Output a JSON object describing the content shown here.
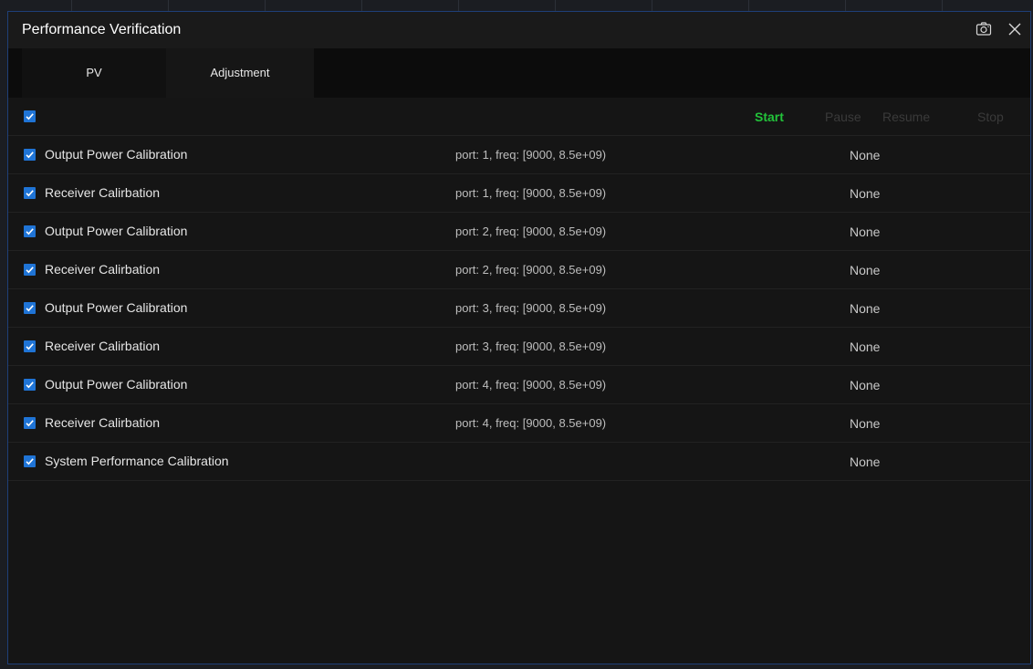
{
  "window": {
    "title": "Performance Verification"
  },
  "tabs": [
    {
      "label": "PV"
    },
    {
      "label": "Adjustment"
    }
  ],
  "toolbar": {
    "select_all_checked": true,
    "start_label": "Start",
    "pause_label": "Pause",
    "resume_label": "Resume",
    "stop_label": "Stop"
  },
  "colors": {
    "accent": "#1f74d6",
    "start": "#22c33a",
    "disabled": "#3a3a3a",
    "window_border": "#1f3f78"
  },
  "icons": {
    "screenshot": "camera-icon",
    "close": "close-icon",
    "check": "checkmark-icon"
  },
  "rows": [
    {
      "checked": true,
      "name": "Output Power Calibration",
      "params": "port: 1, freq: [9000, 8.5e+09)",
      "result": "None"
    },
    {
      "checked": true,
      "name": "Receiver Calirbation",
      "params": "port: 1, freq: [9000, 8.5e+09)",
      "result": "None"
    },
    {
      "checked": true,
      "name": "Output Power Calibration",
      "params": "port: 2, freq: [9000, 8.5e+09)",
      "result": "None"
    },
    {
      "checked": true,
      "name": "Receiver Calirbation",
      "params": "port: 2, freq: [9000, 8.5e+09)",
      "result": "None"
    },
    {
      "checked": true,
      "name": "Output Power Calibration",
      "params": "port: 3, freq: [9000, 8.5e+09)",
      "result": "None"
    },
    {
      "checked": true,
      "name": "Receiver Calirbation",
      "params": "port: 3, freq: [9000, 8.5e+09)",
      "result": "None"
    },
    {
      "checked": true,
      "name": "Output Power Calibration",
      "params": "port: 4, freq: [9000, 8.5e+09)",
      "result": "None"
    },
    {
      "checked": true,
      "name": "Receiver Calirbation",
      "params": "port: 4, freq: [9000, 8.5e+09)",
      "result": "None"
    },
    {
      "checked": true,
      "name": "System Performance Calibration",
      "params": "",
      "result": "None"
    }
  ]
}
